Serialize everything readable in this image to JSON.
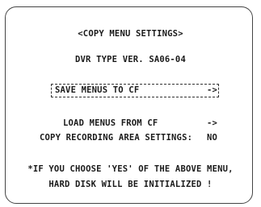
{
  "menu": {
    "title": "<COPY MENU SETTINGS>",
    "version": "DVR TYPE VER. SA06-04",
    "items": [
      {
        "label": "SAVE MENUS TO CF",
        "value": "->",
        "selected": true
      },
      {
        "label": "LOAD MENUS FROM CF",
        "value": "->",
        "selected": false
      },
      {
        "label": "COPY RECORDING AREA SETTINGS:",
        "value": "NO",
        "selected": false
      }
    ],
    "warning_line_1": "*IF YOU CHOOSE 'YES' OF THE ABOVE MENU,",
    "warning_line_2": "HARD DISK WILL BE INITIALIZED !"
  }
}
